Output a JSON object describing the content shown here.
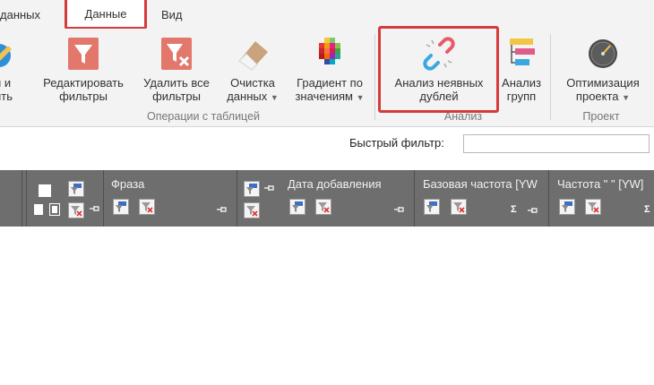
{
  "tabs": [
    {
      "label": "данных"
    },
    {
      "label": "Данные"
    },
    {
      "label": "Вид"
    }
  ],
  "ribbon": {
    "buttons": [
      {
        "label_l1": "и и",
        "label_l2": "ить"
      },
      {
        "label_l1": "Редактировать",
        "label_l2": "фильтры"
      },
      {
        "label_l1": "Удалить все",
        "label_l2": "фильтры"
      },
      {
        "label_l1": "Очистка",
        "label_l2": "данных"
      },
      {
        "label_l1": "Градиент по",
        "label_l2": "значениям"
      },
      {
        "label_l1": "Анализ неявных",
        "label_l2": "дублей"
      },
      {
        "label_l1": "Анализ",
        "label_l2": "групп"
      },
      {
        "label_l1": "Оптимизация",
        "label_l2": "проекта"
      }
    ],
    "groups": {
      "table_ops": "Операции с таблицей",
      "analysis": "Анализ",
      "project": "Проект"
    }
  },
  "quick_filter": {
    "label": "Быстрый фильтр:",
    "value": ""
  },
  "grid": {
    "columns": [
      {
        "label": "Фраза"
      },
      {
        "label": "Дата добавления"
      },
      {
        "label": "Базовая частота [YW"
      },
      {
        "label": "Частота \" \" [YW]"
      }
    ],
    "sigma": "Σ"
  },
  "colors": {
    "accent_border": "#d63b3b",
    "header_bg": "#6e6e6e",
    "ribbon_bg": "#f3f3f3"
  }
}
